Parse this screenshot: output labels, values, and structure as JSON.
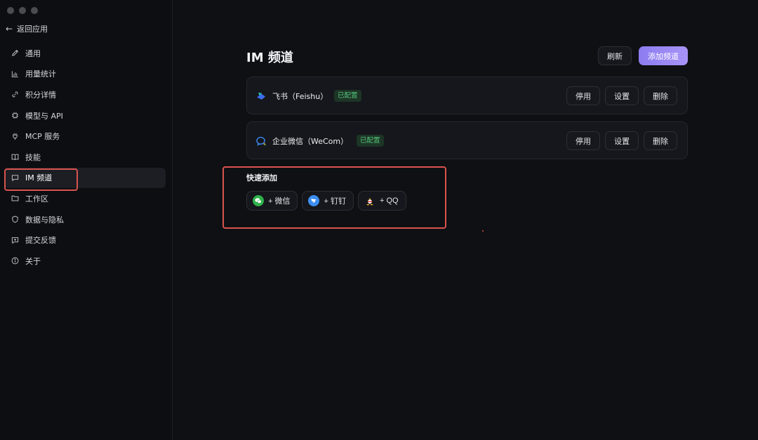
{
  "back": {
    "label": "返回应用"
  },
  "sidebar": {
    "items": [
      {
        "label": "通用",
        "icon": "pencil-icon"
      },
      {
        "label": "用量统计",
        "icon": "bar-chart-icon"
      },
      {
        "label": "积分详情",
        "icon": "link-icon"
      },
      {
        "label": "模型与 API",
        "icon": "chip-icon"
      },
      {
        "label": "MCP 服务",
        "icon": "plug-icon"
      },
      {
        "label": "技能",
        "icon": "book-icon"
      },
      {
        "label": "IM 频道",
        "icon": "chat-icon",
        "active": true
      },
      {
        "label": "工作区",
        "icon": "folder-icon"
      },
      {
        "label": "数据与隐私",
        "icon": "shield-icon"
      },
      {
        "label": "提交反馈",
        "icon": "feedback-icon"
      },
      {
        "label": "关于",
        "icon": "info-icon"
      }
    ]
  },
  "main": {
    "title": "IM 频道",
    "refresh_label": "刷新",
    "add_label": "添加频道",
    "channels": [
      {
        "name": "飞书（Feishu）",
        "status": "已配置",
        "icon": "feishu-logo-icon",
        "actions": {
          "disable": "停用",
          "settings": "设置",
          "delete": "删除"
        }
      },
      {
        "name": "企业微信（WeCom）",
        "status": "已配置",
        "icon": "wecom-logo-icon",
        "actions": {
          "disable": "停用",
          "settings": "设置",
          "delete": "删除"
        }
      }
    ],
    "quick_add": {
      "title": "快速添加",
      "options": [
        {
          "label": "+ 微信",
          "icon": "wechat-icon"
        },
        {
          "label": "+ 钉钉",
          "icon": "dingtalk-icon"
        },
        {
          "label": "+ QQ",
          "icon": "qq-icon"
        }
      ]
    }
  },
  "colors": {
    "background": "#0f1013",
    "accent": "#9d8bf5",
    "configured": "#56c47a",
    "annotation": "#d9534f"
  }
}
